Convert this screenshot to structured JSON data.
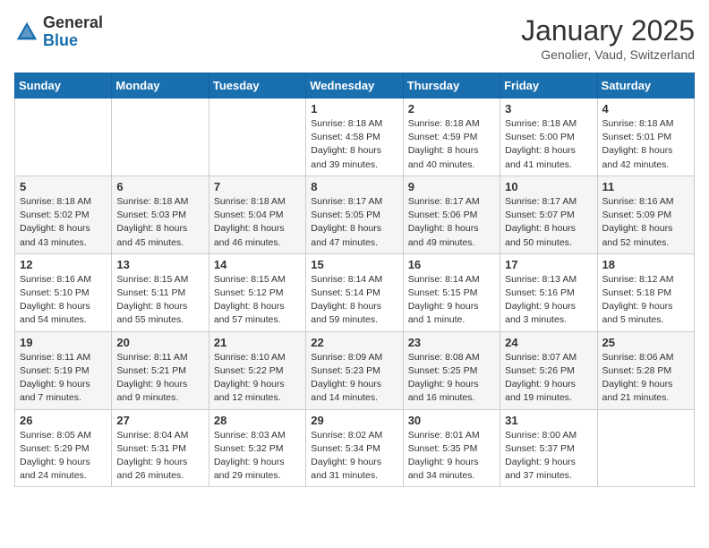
{
  "header": {
    "logo_general": "General",
    "logo_blue": "Blue",
    "month": "January 2025",
    "location": "Genolier, Vaud, Switzerland"
  },
  "days_of_week": [
    "Sunday",
    "Monday",
    "Tuesday",
    "Wednesday",
    "Thursday",
    "Friday",
    "Saturday"
  ],
  "weeks": [
    [
      {
        "day": "",
        "info": ""
      },
      {
        "day": "",
        "info": ""
      },
      {
        "day": "",
        "info": ""
      },
      {
        "day": "1",
        "info": "Sunrise: 8:18 AM\nSunset: 4:58 PM\nDaylight: 8 hours\nand 39 minutes."
      },
      {
        "day": "2",
        "info": "Sunrise: 8:18 AM\nSunset: 4:59 PM\nDaylight: 8 hours\nand 40 minutes."
      },
      {
        "day": "3",
        "info": "Sunrise: 8:18 AM\nSunset: 5:00 PM\nDaylight: 8 hours\nand 41 minutes."
      },
      {
        "day": "4",
        "info": "Sunrise: 8:18 AM\nSunset: 5:01 PM\nDaylight: 8 hours\nand 42 minutes."
      }
    ],
    [
      {
        "day": "5",
        "info": "Sunrise: 8:18 AM\nSunset: 5:02 PM\nDaylight: 8 hours\nand 43 minutes."
      },
      {
        "day": "6",
        "info": "Sunrise: 8:18 AM\nSunset: 5:03 PM\nDaylight: 8 hours\nand 45 minutes."
      },
      {
        "day": "7",
        "info": "Sunrise: 8:18 AM\nSunset: 5:04 PM\nDaylight: 8 hours\nand 46 minutes."
      },
      {
        "day": "8",
        "info": "Sunrise: 8:17 AM\nSunset: 5:05 PM\nDaylight: 8 hours\nand 47 minutes."
      },
      {
        "day": "9",
        "info": "Sunrise: 8:17 AM\nSunset: 5:06 PM\nDaylight: 8 hours\nand 49 minutes."
      },
      {
        "day": "10",
        "info": "Sunrise: 8:17 AM\nSunset: 5:07 PM\nDaylight: 8 hours\nand 50 minutes."
      },
      {
        "day": "11",
        "info": "Sunrise: 8:16 AM\nSunset: 5:09 PM\nDaylight: 8 hours\nand 52 minutes."
      }
    ],
    [
      {
        "day": "12",
        "info": "Sunrise: 8:16 AM\nSunset: 5:10 PM\nDaylight: 8 hours\nand 54 minutes."
      },
      {
        "day": "13",
        "info": "Sunrise: 8:15 AM\nSunset: 5:11 PM\nDaylight: 8 hours\nand 55 minutes."
      },
      {
        "day": "14",
        "info": "Sunrise: 8:15 AM\nSunset: 5:12 PM\nDaylight: 8 hours\nand 57 minutes."
      },
      {
        "day": "15",
        "info": "Sunrise: 8:14 AM\nSunset: 5:14 PM\nDaylight: 8 hours\nand 59 minutes."
      },
      {
        "day": "16",
        "info": "Sunrise: 8:14 AM\nSunset: 5:15 PM\nDaylight: 9 hours\nand 1 minute."
      },
      {
        "day": "17",
        "info": "Sunrise: 8:13 AM\nSunset: 5:16 PM\nDaylight: 9 hours\nand 3 minutes."
      },
      {
        "day": "18",
        "info": "Sunrise: 8:12 AM\nSunset: 5:18 PM\nDaylight: 9 hours\nand 5 minutes."
      }
    ],
    [
      {
        "day": "19",
        "info": "Sunrise: 8:11 AM\nSunset: 5:19 PM\nDaylight: 9 hours\nand 7 minutes."
      },
      {
        "day": "20",
        "info": "Sunrise: 8:11 AM\nSunset: 5:21 PM\nDaylight: 9 hours\nand 9 minutes."
      },
      {
        "day": "21",
        "info": "Sunrise: 8:10 AM\nSunset: 5:22 PM\nDaylight: 9 hours\nand 12 minutes."
      },
      {
        "day": "22",
        "info": "Sunrise: 8:09 AM\nSunset: 5:23 PM\nDaylight: 9 hours\nand 14 minutes."
      },
      {
        "day": "23",
        "info": "Sunrise: 8:08 AM\nSunset: 5:25 PM\nDaylight: 9 hours\nand 16 minutes."
      },
      {
        "day": "24",
        "info": "Sunrise: 8:07 AM\nSunset: 5:26 PM\nDaylight: 9 hours\nand 19 minutes."
      },
      {
        "day": "25",
        "info": "Sunrise: 8:06 AM\nSunset: 5:28 PM\nDaylight: 9 hours\nand 21 minutes."
      }
    ],
    [
      {
        "day": "26",
        "info": "Sunrise: 8:05 AM\nSunset: 5:29 PM\nDaylight: 9 hours\nand 24 minutes."
      },
      {
        "day": "27",
        "info": "Sunrise: 8:04 AM\nSunset: 5:31 PM\nDaylight: 9 hours\nand 26 minutes."
      },
      {
        "day": "28",
        "info": "Sunrise: 8:03 AM\nSunset: 5:32 PM\nDaylight: 9 hours\nand 29 minutes."
      },
      {
        "day": "29",
        "info": "Sunrise: 8:02 AM\nSunset: 5:34 PM\nDaylight: 9 hours\nand 31 minutes."
      },
      {
        "day": "30",
        "info": "Sunrise: 8:01 AM\nSunset: 5:35 PM\nDaylight: 9 hours\nand 34 minutes."
      },
      {
        "day": "31",
        "info": "Sunrise: 8:00 AM\nSunset: 5:37 PM\nDaylight: 9 hours\nand 37 minutes."
      },
      {
        "day": "",
        "info": ""
      }
    ]
  ]
}
